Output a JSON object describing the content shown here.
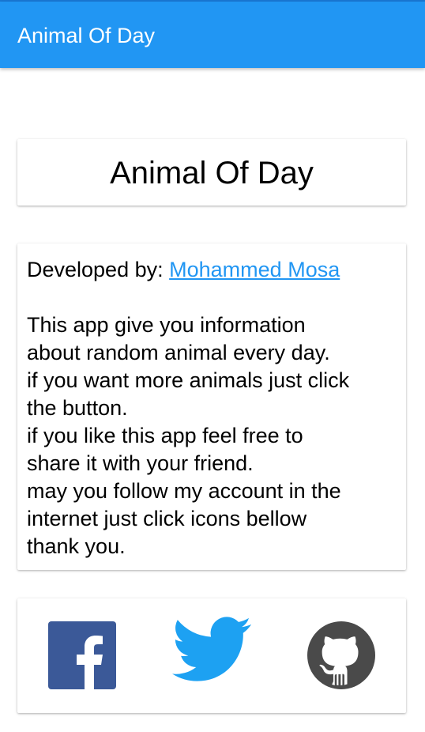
{
  "app_bar": {
    "title": "Animal Of Day",
    "color": "#2196F3"
  },
  "title_card": {
    "text": "Animal Of Day"
  },
  "info_card": {
    "developer_label": "Developed by:",
    "developer_name": "Mohammed Mosa",
    "link_color": "#2196F3",
    "description_lines": [
      "This app give you information",
      "about random animal every day.",
      "if you want more animals just click",
      "the button.",
      "if you like this app feel free to",
      "share it with your friend.",
      "may you follow my account in the",
      "internet just click icons bellow",
      "thank you."
    ]
  },
  "social": {
    "icons": [
      "facebook-icon",
      "twitter-icon",
      "github-icon"
    ],
    "facebook_color": "#3B5998",
    "twitter_color": "#1DA1F2",
    "github_color": "#4A4A4A"
  }
}
